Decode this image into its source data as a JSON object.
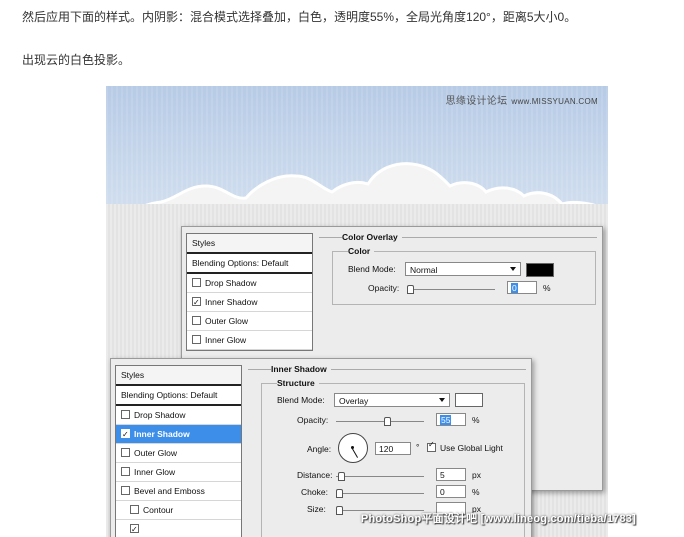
{
  "article": {
    "paragraph1": "然后应用下面的样式。内阴影：混合模式选择叠加，白色，透明度55%，全局光角度120°，距离5大小0。",
    "paragraph2": "出现云的白色投影。"
  },
  "screenshot": {
    "watermark_top_cn": "思缘设计论坛",
    "watermark_top_en": "www.MISSYUAN.COM",
    "watermark_bottom": "PhotoShop平面设计吧 [www.lineog.com/tieba/1783]",
    "colors": {
      "sky": "#c2d3ea",
      "ground": "#e6e6e6",
      "selection": "#3d8ee8"
    }
  },
  "back_dialog": {
    "styles_header": "Styles",
    "blending_options": "Blending Options: Default",
    "items": [
      {
        "label": "Drop Shadow",
        "checked": false
      },
      {
        "label": "Inner Shadow",
        "checked": true
      },
      {
        "label": "Outer Glow",
        "checked": false
      },
      {
        "label": "Inner Glow",
        "checked": false
      }
    ],
    "section_title": "Color Overlay",
    "group_title": "Color",
    "blend_mode_label": "Blend Mode:",
    "blend_mode_value": "Normal",
    "opacity_label": "Opacity:",
    "opacity_value": "0",
    "opacity_unit": "%",
    "swatch_color": "#000000"
  },
  "front_dialog": {
    "styles_header": "Styles",
    "blending_options": "Blending Options: Default",
    "items": [
      {
        "label": "Drop Shadow",
        "checked": false
      },
      {
        "label": "Inner Shadow",
        "checked": true,
        "selected": true
      },
      {
        "label": "Outer Glow",
        "checked": false
      },
      {
        "label": "Inner Glow",
        "checked": false
      },
      {
        "label": "Bevel and Emboss",
        "checked": false
      },
      {
        "label": "Contour",
        "checked": false
      }
    ],
    "section_title": "Inner Shadow",
    "group_title": "Structure",
    "blend_mode_label": "Blend Mode:",
    "blend_mode_value": "Overlay",
    "swatch_color": "#ffffff",
    "opacity_label": "Opacity:",
    "opacity_value": "55",
    "opacity_unit": "%",
    "angle_label": "Angle:",
    "angle_value": "120",
    "angle_unit": "°",
    "global_light_label": "Use Global Light",
    "global_light_checked": true,
    "distance_label": "Distance:",
    "distance_value": "5",
    "distance_unit": "px",
    "choke_label": "Choke:",
    "choke_value": "0",
    "choke_unit": "%",
    "size_label": "Size:",
    "size_unit": "px"
  }
}
